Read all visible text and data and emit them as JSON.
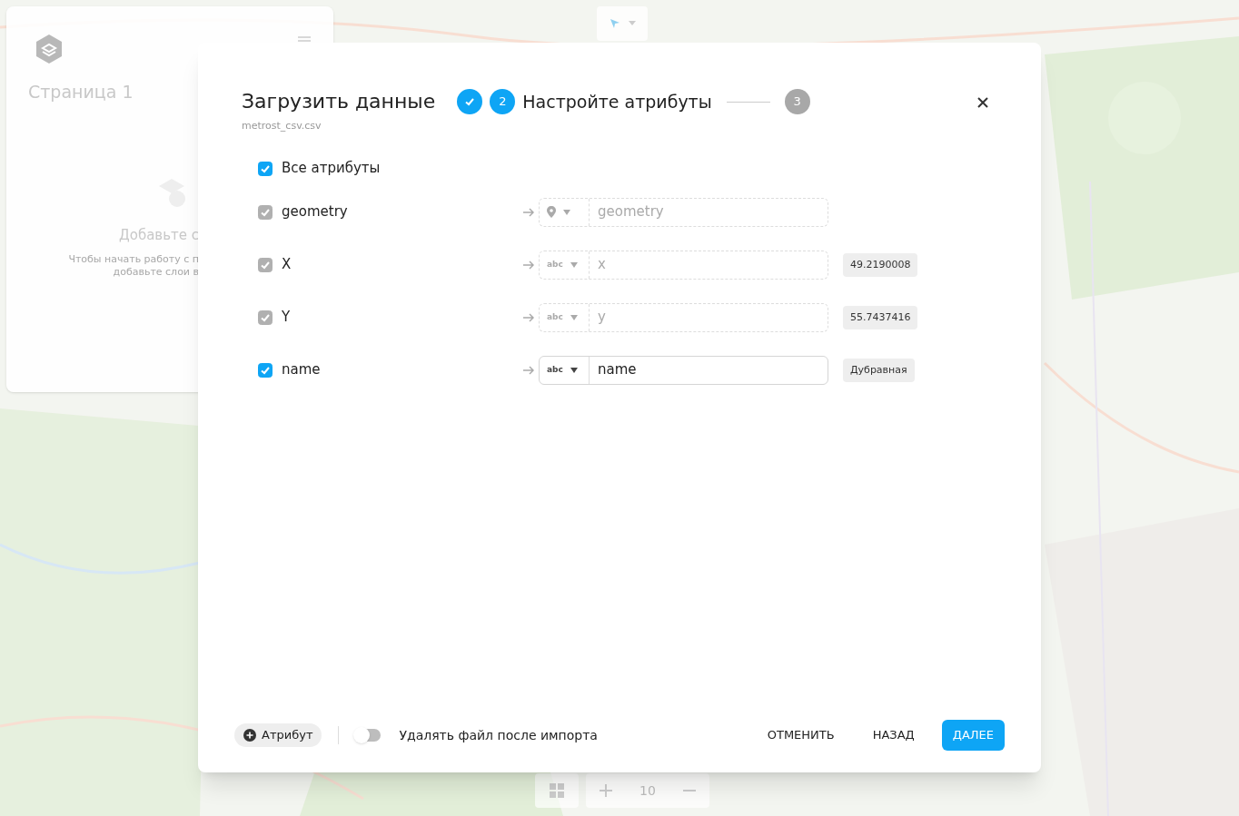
{
  "sidebar": {
    "title": "Страница 1",
    "empty_title": "Добавьте с",
    "empty_hint_lines": [
      "Чтобы начать работу с п",
      "добавьте слои в"
    ]
  },
  "map_controls": {
    "zoom": "10"
  },
  "dialog": {
    "title": "Загрузить данные",
    "file_name": "metrost_csv.csv",
    "steps": [
      {
        "completed": true,
        "selected": false
      },
      {
        "completed": false,
        "selected": true,
        "number": "2",
        "label": "Настройте атрибуты"
      },
      {
        "completed": false,
        "selected": false,
        "number": "3"
      }
    ],
    "all_attributes": {
      "label": "Все атрибуты",
      "checked": true
    },
    "attributes": [
      {
        "name": "geometry",
        "checked": true,
        "disabled": true,
        "kind": "geometry",
        "value": "geometry"
      },
      {
        "name": "X",
        "checked": true,
        "disabled": true,
        "kind": "text",
        "type_label": "abc",
        "value": "x",
        "sample": "49.2190008"
      },
      {
        "name": "Y",
        "checked": true,
        "disabled": true,
        "kind": "text",
        "type_label": "abc",
        "value": "y",
        "sample": "55.7437416"
      },
      {
        "name": "name",
        "checked": true,
        "disabled": false,
        "kind": "text",
        "type_label": "abc",
        "value": "name",
        "sample": "Дубравная"
      }
    ],
    "add_attribute": "Атрибут",
    "delete_toggle": {
      "label": "Удалять файл после импорта",
      "on": false
    },
    "buttons": {
      "cancel": "ОТМЕНИТЬ",
      "back": "НАЗАД",
      "next": "ДАЛЕЕ"
    }
  }
}
